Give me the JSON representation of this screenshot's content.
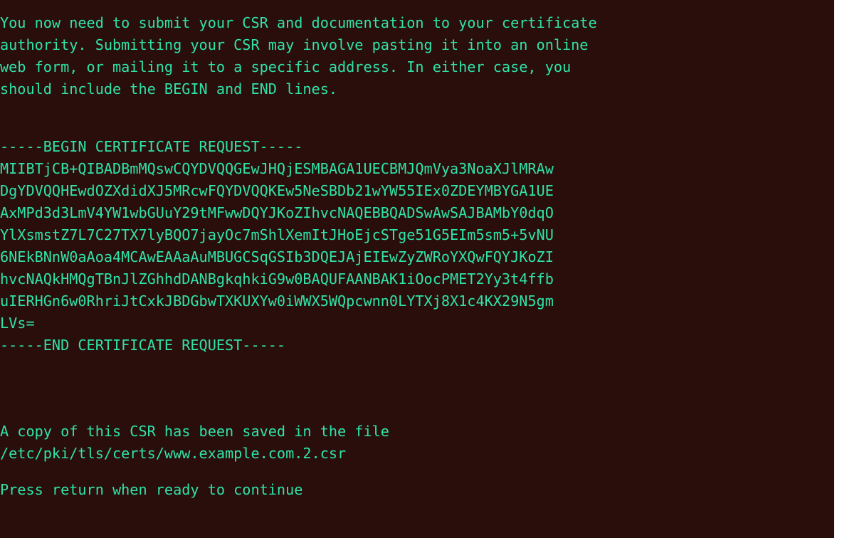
{
  "terminal": {
    "intro": [
      "You now need to submit your CSR and documentation to your certificate",
      "authority. Submitting your CSR may involve pasting it into an online",
      "web form, or mailing it to a specific address. In either case, you",
      "should include the BEGIN and END lines."
    ],
    "csr": {
      "begin": "-----BEGIN CERTIFICATE REQUEST-----",
      "body": [
        "MIIBTjCB+QIBADBmMQswCQYDVQQGEwJHQjESMBAGA1UECBMJQmVya3NoaXJlMRAw",
        "DgYDVQQHEwdOZXdidXJ5MRcwFQYDVQQKEw5NeSBDb21wYW55IEx0ZDEYMBYGA1UE",
        "AxMPd3d3LmV4YW1wbGUuY29tMFwwDQYJKoZIhvcNAQEBBQADSwAwSAJBAMbY0dqO",
        "YlXsmstZ7L7C27TX7lyBQO7jayOc7mShlXemItJHoEjcSTge51G5EIm5sm5+5vNU",
        "6NEkBNnW0aAoa4MCAwEAAaAuMBUGCSqGSIb3DQEJAjEIEwZyZWRoYXQwFQYJKoZI",
        "hvcNAQkHMQgTBnJlZGhhdDANBgkqhkiG9w0BAQUFAANBAK1iOocPMET2Yy3t4ffb",
        "uIERHGn6w0RhriJtCxkJBDGbwTXKUXYw0iWWX5WQpcwnn0LYTXj8X1c4KX29N5gm",
        "LVs="
      ],
      "end": "-----END CERTIFICATE REQUEST-----"
    },
    "saved_line_1": "A copy of this CSR has been saved in the file",
    "saved_line_2": "/etc/pki/tls/certs/www.example.com.2.csr",
    "prompt": "Press return when ready to continue"
  },
  "colors": {
    "background": "#2a0e0c",
    "text": "#2fe3a8"
  }
}
